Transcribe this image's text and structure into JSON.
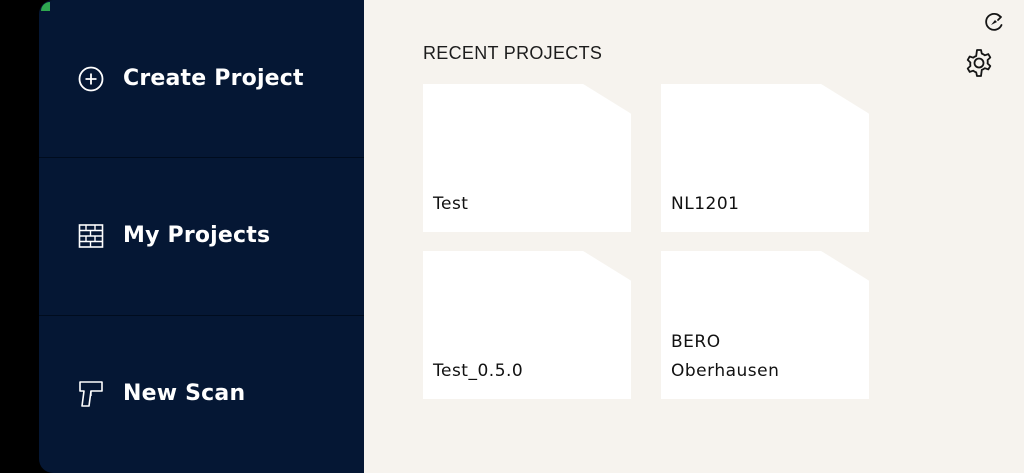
{
  "sidebar": {
    "items": [
      {
        "label": "Create Project",
        "icon": "plus-circle-icon"
      },
      {
        "label": "My Projects",
        "icon": "brick-wall-icon"
      },
      {
        "label": "New Scan",
        "icon": "scanner-gun-icon"
      }
    ]
  },
  "main": {
    "section_title": "RECENT PROJECTS",
    "projects": [
      {
        "name": "Test"
      },
      {
        "name": "NL1201"
      },
      {
        "name": "Test_0.5.0"
      },
      {
        "name": "BERO\nOberhausen"
      }
    ]
  },
  "icons": {
    "top_right_sync": "sync-disabled-icon",
    "settings": "gear-icon"
  },
  "colors": {
    "sidebar_bg": "#051734",
    "main_bg": "#f6f3ee",
    "card_bg": "#ffffff",
    "status_dot": "#2fa84f"
  }
}
